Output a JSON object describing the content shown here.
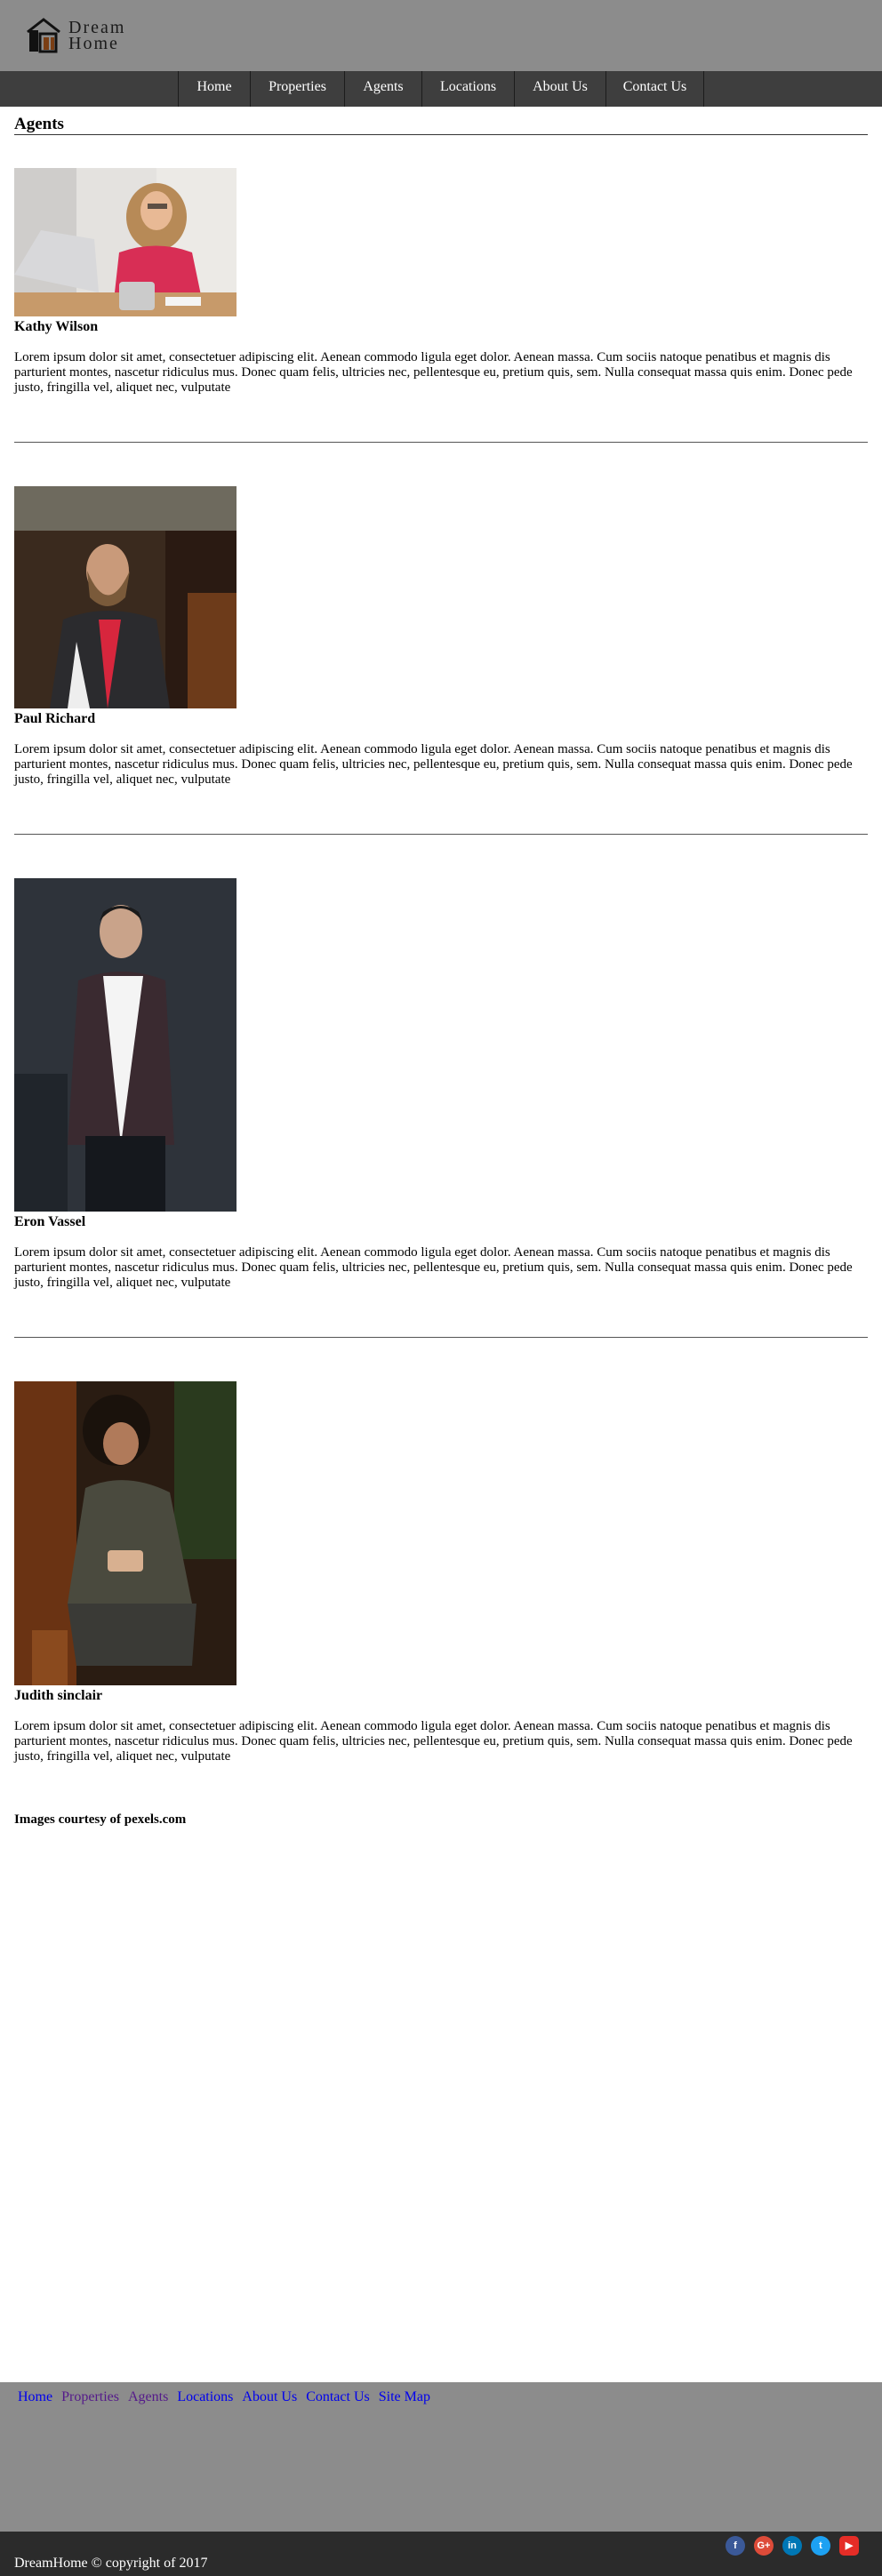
{
  "header": {
    "logo": {
      "word1": "Dream",
      "word2": "Home"
    }
  },
  "nav": {
    "items": [
      {
        "label": "Home"
      },
      {
        "label": "Properties"
      },
      {
        "label": "Agents"
      },
      {
        "label": "Locations"
      },
      {
        "label": "About Us"
      },
      {
        "label": "Contact Us"
      }
    ]
  },
  "main": {
    "title": "Agents",
    "agents": [
      {
        "name": "Kathy Wilson",
        "photo_icon": "agent-photo-woman-laptop",
        "bio": "Lorem ipsum dolor sit amet, consectetuer adipiscing elit. Aenean commodo ligula eget dolor. Aenean massa. Cum sociis natoque penatibus et magnis dis parturient montes, nascetur ridiculus mus. Donec quam felis, ultricies nec, pellentesque eu, pretium quis, sem. Nulla consequat massa quis enim. Donec pede justo, fringilla vel, aliquet nec, vulputate"
      },
      {
        "name": "Paul Richard",
        "photo_icon": "agent-photo-bearded-man",
        "bio": "Lorem ipsum dolor sit amet, consectetuer adipiscing elit. Aenean commodo ligula eget dolor. Aenean massa. Cum sociis natoque penatibus et magnis dis parturient montes, nascetur ridiculus mus. Donec quam felis, ultricies nec, pellentesque eu, pretium quis, sem. Nulla consequat massa quis enim. Donec pede justo, fringilla vel, aliquet nec, vulputate"
      },
      {
        "name": "Eron Vassel",
        "photo_icon": "agent-photo-man-blazer",
        "bio": "Lorem ipsum dolor sit amet, consectetuer adipiscing elit. Aenean commodo ligula eget dolor. Aenean massa. Cum sociis natoque penatibus et magnis dis parturient montes, nascetur ridiculus mus. Donec quam felis, ultricies nec, pellentesque eu, pretium quis, sem. Nulla consequat massa quis enim. Donec pede justo, fringilla vel, aliquet nec, vulputate"
      },
      {
        "name": "Judith sinclair",
        "photo_icon": "agent-photo-woman-phone",
        "bio": "Lorem ipsum dolor sit amet, consectetuer adipiscing elit. Aenean commodo ligula eget dolor. Aenean massa. Cum sociis natoque penatibus et magnis dis parturient montes, nascetur ridiculus mus. Donec quam felis, ultricies nec, pellentesque eu, pretium quis, sem. Nulla consequat massa quis enim. Donec pede justo, fringilla vel, aliquet nec, vulputate"
      }
    ],
    "credit": "Images courtesy of pexels.com"
  },
  "footer": {
    "links": [
      {
        "label": "Home",
        "visited": false
      },
      {
        "label": "Properties",
        "visited": true
      },
      {
        "label": "Agents",
        "visited": true
      },
      {
        "label": "Locations",
        "visited": false
      },
      {
        "label": "About Us",
        "visited": false
      },
      {
        "label": "Contact Us",
        "visited": false
      },
      {
        "label": "Site Map",
        "visited": false
      }
    ],
    "copyright": "DreamHome © copyright of 2017",
    "social": [
      {
        "icon": "facebook-icon",
        "glyph": "f",
        "color": "#3b5998"
      },
      {
        "icon": "google-plus-icon",
        "glyph": "G+",
        "color": "#dd4b39"
      },
      {
        "icon": "linkedin-icon",
        "glyph": "in",
        "color": "#0077b5"
      },
      {
        "icon": "twitter-icon",
        "glyph": "t",
        "color": "#1da1f2"
      },
      {
        "icon": "youtube-icon",
        "glyph": "▶",
        "color": "#e52d27"
      }
    ]
  },
  "colors": {
    "header_bg": "#8c8c8c",
    "nav_bg": "#3e3e3e",
    "footer_bg": "#8c8c8c",
    "bottom_bar_bg": "#2b2b2b",
    "link": "#0000ee",
    "link_visited": "#551a8b"
  }
}
